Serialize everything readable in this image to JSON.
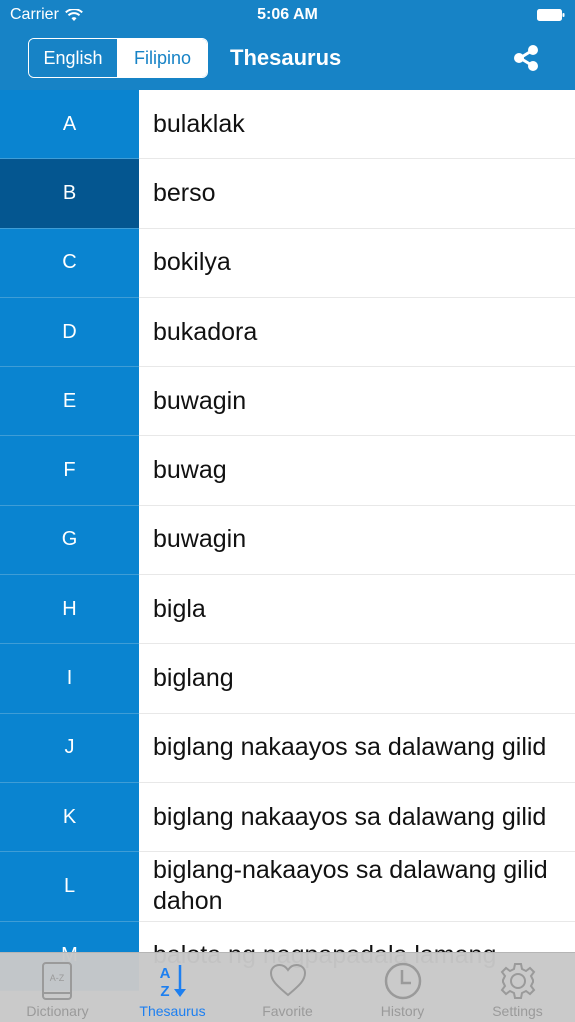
{
  "status_bar": {
    "carrier": "Carrier",
    "time": "5:06 AM"
  },
  "header": {
    "languages": [
      "English",
      "Filipino"
    ],
    "selected_language": "English",
    "title": "Thesaurus",
    "share_icon": "share-icon"
  },
  "colors": {
    "accent": "#1783c6",
    "letter_bg": "#0a84d0",
    "letter_selected_bg": "#045690",
    "tab_active": "#1d7ff0"
  },
  "rows": [
    {
      "letter": "A",
      "word": "bulaklak"
    },
    {
      "letter": "B",
      "word": "berso",
      "selected": true
    },
    {
      "letter": "C",
      "word": "bokilya"
    },
    {
      "letter": "D",
      "word": "bukadora"
    },
    {
      "letter": "E",
      "word": "buwagin"
    },
    {
      "letter": "F",
      "word": "buwag"
    },
    {
      "letter": "G",
      "word": "buwagin"
    },
    {
      "letter": "H",
      "word": "bigla"
    },
    {
      "letter": "I",
      "word": "biglang"
    },
    {
      "letter": "J",
      "word": "biglang nakaayos sa dalawang gilid"
    },
    {
      "letter": "K",
      "word": "biglang nakaayos sa dalawang gilid"
    },
    {
      "letter": "L",
      "word": "biglang-nakaayos sa dalawang gilid dahon"
    },
    {
      "letter": "M",
      "word": "balota ng nagpapadala lamang"
    }
  ],
  "tabs": [
    {
      "label": "Dictionary",
      "icon": "dictionary-book-icon"
    },
    {
      "label": "Thesaurus",
      "icon": "az-sort-icon",
      "active": true
    },
    {
      "label": "Favorite",
      "icon": "heart-icon"
    },
    {
      "label": "History",
      "icon": "clock-icon"
    },
    {
      "label": "Settings",
      "icon": "gear-icon"
    }
  ]
}
